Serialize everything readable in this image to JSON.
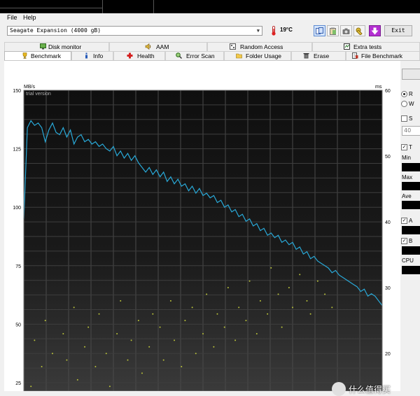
{
  "menu": {
    "file": "File",
    "help": "Help"
  },
  "toolbar": {
    "drive": "Seagate Expansion (4000 gB)",
    "temperature": "19",
    "temperature_unit": "°C",
    "exit_label": "Exit"
  },
  "tabs_row1": [
    {
      "label": "Disk monitor",
      "icon": "disk-monitor-icon"
    },
    {
      "label": "AAM",
      "icon": "speaker-icon"
    },
    {
      "label": "Random Access",
      "icon": "random-access-icon"
    },
    {
      "label": "Extra tests",
      "icon": "extra-tests-icon"
    }
  ],
  "tabs_row2": [
    {
      "label": "Benchmark",
      "icon": "trophy-icon",
      "selected": true
    },
    {
      "label": "Info",
      "icon": "info-icon"
    },
    {
      "label": "Health",
      "icon": "health-cross-icon"
    },
    {
      "label": "Error Scan",
      "icon": "error-scan-icon"
    },
    {
      "label": "Folder Usage",
      "icon": "folder-icon"
    },
    {
      "label": "Erase",
      "icon": "trash-icon"
    },
    {
      "label": "File Benchmark",
      "icon": "file-benchmark-icon"
    }
  ],
  "chart_data": {
    "type": "line",
    "watermark_text": "trial version",
    "left_axis": {
      "unit": "MB/s",
      "min": 25,
      "max": 150,
      "ticks": [
        150,
        125,
        100,
        75,
        50,
        25
      ]
    },
    "right_axis": {
      "unit": "ms",
      "min": 10,
      "max": 60,
      "ticks": [
        60,
        50,
        40,
        30,
        20
      ]
    },
    "x_range": [
      0,
      100
    ],
    "grid": true,
    "series": [
      {
        "kind": "transfer-rate",
        "axis": "left",
        "color": "#29a9d8",
        "x": [
          0,
          1,
          2,
          3,
          4,
          5,
          6,
          7,
          8,
          9,
          10,
          11,
          12,
          13,
          14,
          15,
          16,
          17,
          18,
          19,
          20,
          21,
          22,
          23,
          24,
          25,
          26,
          27,
          28,
          29,
          30,
          31,
          32,
          33,
          34,
          35,
          36,
          37,
          38,
          39,
          40,
          41,
          42,
          43,
          44,
          45,
          46,
          47,
          48,
          49,
          50,
          51,
          52,
          53,
          54,
          55,
          56,
          57,
          58,
          59,
          60,
          61,
          62,
          63,
          64,
          65,
          66,
          67,
          68,
          69,
          70,
          71,
          72,
          73,
          74,
          75,
          76,
          77,
          78,
          79,
          80,
          81,
          82,
          83,
          84,
          85,
          86,
          87,
          88,
          89,
          90,
          91,
          92,
          93,
          94,
          95,
          96,
          97,
          98,
          99,
          100
        ],
        "y": [
          95,
          134,
          137,
          135,
          136,
          134,
          128,
          133,
          136,
          132,
          131,
          134,
          130,
          133,
          127,
          130,
          131,
          128,
          129,
          127,
          128,
          126,
          127,
          125,
          124,
          126,
          122,
          124,
          121,
          123,
          120,
          122,
          119,
          117,
          115,
          117,
          114,
          116,
          113,
          115,
          111,
          113,
          110,
          112,
          109,
          110,
          107,
          109,
          106,
          108,
          105,
          106,
          104,
          105,
          102,
          103,
          100,
          101,
          98,
          99,
          96,
          97,
          94,
          95,
          92,
          93,
          90,
          91,
          88,
          89,
          87,
          88,
          85,
          86,
          84,
          85,
          82,
          83,
          80,
          81,
          78,
          79,
          77,
          76,
          75,
          74,
          72,
          73,
          71,
          70,
          69,
          68,
          67,
          66,
          64,
          65,
          62,
          63,
          62,
          60,
          58
        ]
      },
      {
        "kind": "access-time",
        "axis": "right",
        "color": "#b9c23a",
        "x": [
          2,
          3,
          5,
          6,
          8,
          9,
          11,
          12,
          14,
          15,
          17,
          18,
          20,
          21,
          23,
          24,
          26,
          27,
          29,
          30,
          32,
          33,
          35,
          36,
          38,
          39,
          41,
          42,
          44,
          45,
          47,
          48,
          50,
          51,
          53,
          54,
          56,
          57,
          59,
          60,
          62,
          63,
          65,
          66,
          68,
          69,
          71,
          72,
          74,
          75,
          77,
          79,
          80,
          82,
          84,
          86
        ],
        "y": [
          15,
          22,
          18,
          25,
          20,
          14,
          23,
          19,
          27,
          16,
          21,
          24,
          18,
          26,
          20,
          15,
          23,
          28,
          19,
          22,
          25,
          17,
          21,
          26,
          24,
          19,
          28,
          22,
          18,
          25,
          27,
          20,
          23,
          29,
          21,
          26,
          24,
          30,
          22,
          27,
          25,
          31,
          23,
          28,
          26,
          33,
          29,
          24,
          30,
          27,
          32,
          28,
          26,
          31,
          29,
          27
        ]
      }
    ]
  },
  "right_panel": {
    "labels": [
      "R",
      "W",
      "S",
      "40",
      "T",
      "Min",
      "Max",
      "Ave",
      "A",
      "B",
      "CPU"
    ]
  },
  "watermark": "什么值得买"
}
